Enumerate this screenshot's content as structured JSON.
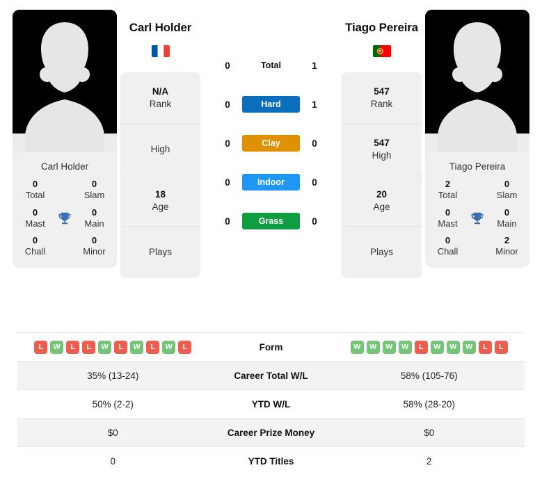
{
  "players": {
    "left": {
      "name": "Carl Holder",
      "card_name": "Carl Holder",
      "flag": "france-flag",
      "flag_colors": [
        "#0055A4",
        "#FFFFFF",
        "#EF4135"
      ],
      "titles": {
        "total_value": "0",
        "total_label": "Total",
        "slam_value": "0",
        "slam_label": "Slam",
        "mast_value": "0",
        "mast_label": "Mast",
        "main_value": "0",
        "main_label": "Main",
        "chall_value": "0",
        "chall_label": "Chall",
        "minor_value": "0",
        "minor_label": "Minor"
      },
      "info": [
        {
          "value": "N/A",
          "label": "Rank"
        },
        {
          "value": "",
          "label": "High"
        },
        {
          "value": "18",
          "label": "Age"
        },
        {
          "value": "",
          "label": "Plays"
        }
      ]
    },
    "right": {
      "name": "Tiago Pereira",
      "card_name": "Tiago Pereira",
      "flag": "portugal-flag",
      "flag_colors": [
        "#006600",
        "#FF0000",
        "#FFD700"
      ],
      "titles": {
        "total_value": "2",
        "total_label": "Total",
        "slam_value": "0",
        "slam_label": "Slam",
        "mast_value": "0",
        "mast_label": "Mast",
        "main_value": "0",
        "main_label": "Main",
        "chall_value": "0",
        "chall_label": "Chall",
        "minor_value": "2",
        "minor_label": "Minor"
      },
      "info": [
        {
          "value": "547",
          "label": "Rank"
        },
        {
          "value": "547",
          "label": "High"
        },
        {
          "value": "20",
          "label": "Age"
        },
        {
          "value": "",
          "label": "Plays"
        }
      ]
    }
  },
  "surfaces": [
    {
      "label": "Total",
      "left": "0",
      "right": "1",
      "color": "transparent",
      "text_color": "#111111"
    },
    {
      "label": "Hard",
      "left": "0",
      "right": "1",
      "color": "#0b6ebd",
      "text_color": "#ffffff"
    },
    {
      "label": "Clay",
      "left": "0",
      "right": "0",
      "color": "#e09100",
      "text_color": "#ffffff"
    },
    {
      "label": "Indoor",
      "left": "0",
      "right": "0",
      "color": "#2196f3",
      "text_color": "#ffffff"
    },
    {
      "label": "Grass",
      "left": "0",
      "right": "0",
      "color": "#0f9d41",
      "text_color": "#ffffff"
    }
  ],
  "table": {
    "rows": [
      {
        "label": "Form",
        "type": "form",
        "left_form": [
          "L",
          "W",
          "L",
          "L",
          "W",
          "L",
          "W",
          "L",
          "W",
          "L"
        ],
        "right_form": [
          "W",
          "W",
          "W",
          "W",
          "L",
          "W",
          "W",
          "W",
          "L",
          "L"
        ],
        "alt": false
      },
      {
        "label": "Career Total W/L",
        "type": "text",
        "left": "35% (13-24)",
        "right": "58% (105-76)",
        "alt": true
      },
      {
        "label": "YTD W/L",
        "type": "text",
        "left": "50% (2-2)",
        "right": "58% (28-20)",
        "alt": false
      },
      {
        "label": "Career Prize Money",
        "type": "text",
        "left": "$0",
        "right": "$0",
        "alt": true
      },
      {
        "label": "YTD Titles",
        "type": "text",
        "left": "0",
        "right": "2",
        "alt": false
      }
    ]
  },
  "icons": {
    "trophy": "trophy-icon",
    "avatar": "avatar-placeholder-icon"
  },
  "colors": {
    "win": "#76c479",
    "loss": "#ec5f50",
    "card_bg": "#f0f0f0",
    "row_alt": "#f3f3f3",
    "trophy": "#3a6fb0"
  }
}
